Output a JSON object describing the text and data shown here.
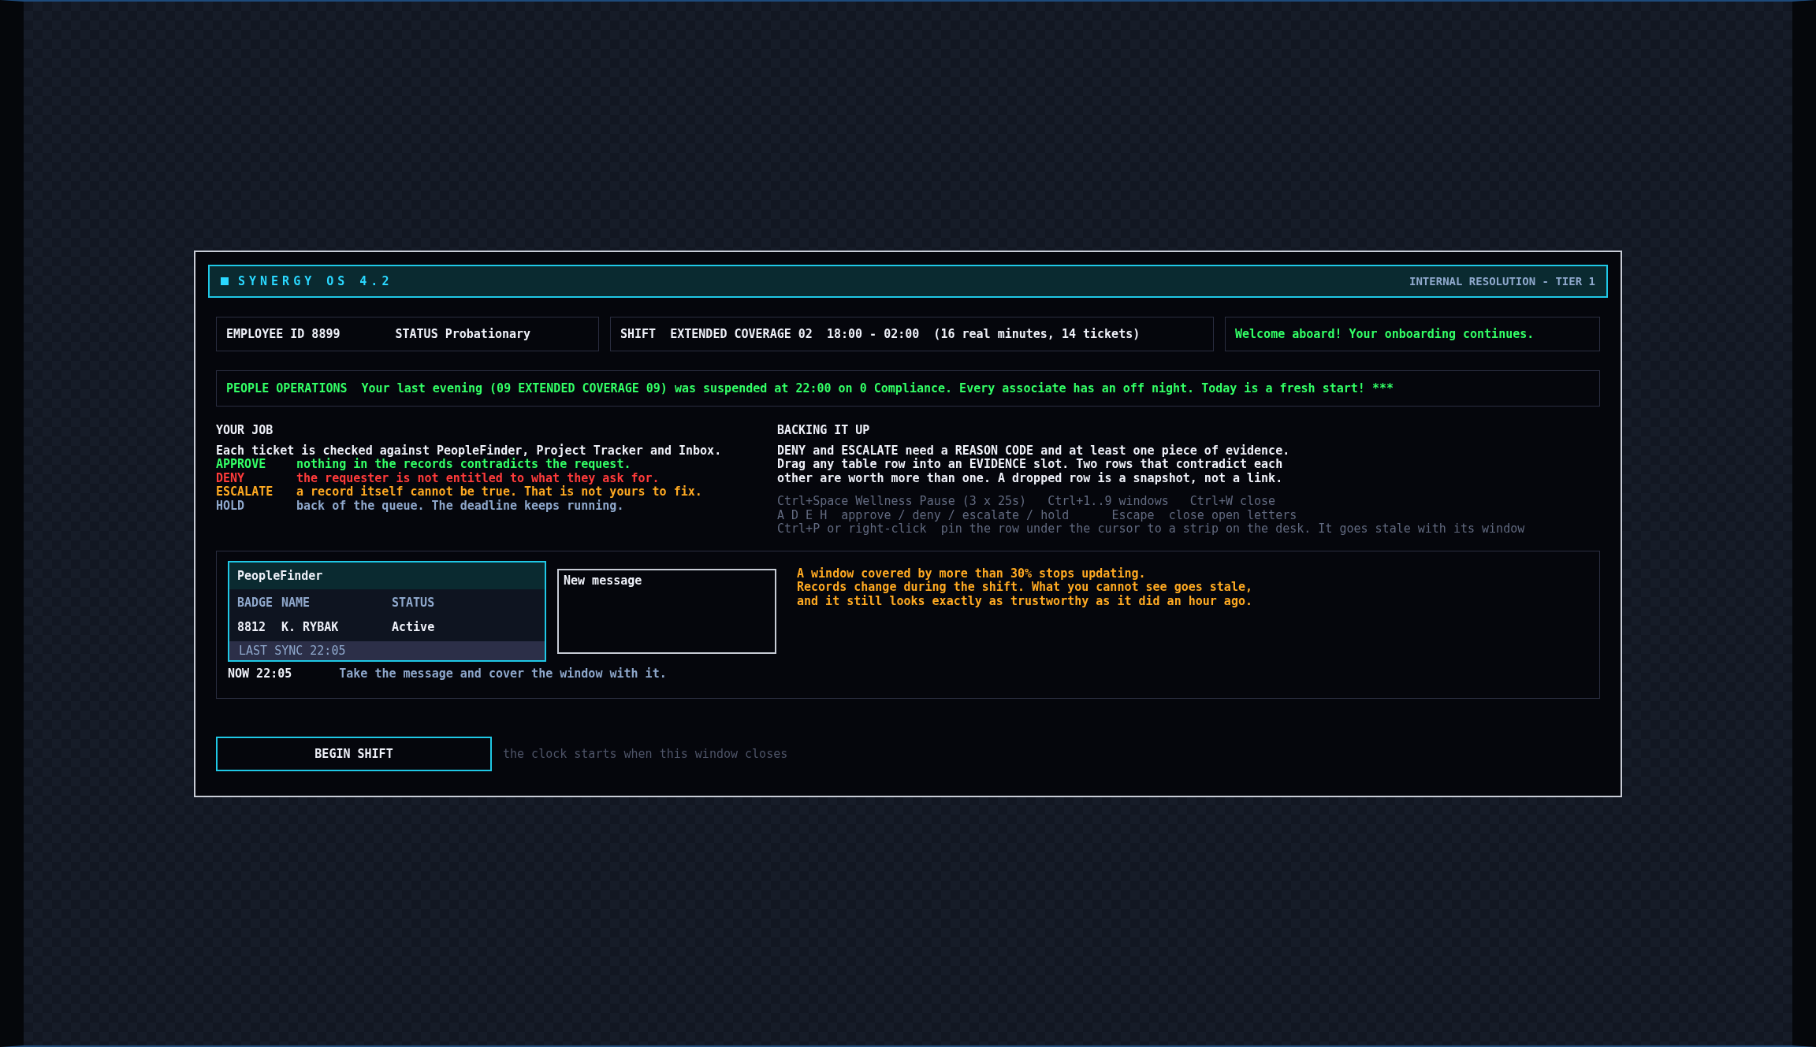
{
  "window": {
    "title": "SYNERGY OS 4.2",
    "tier": "INTERNAL RESOLUTION - TIER 1"
  },
  "info": {
    "employee": "EMPLOYEE ID 8899",
    "status": "STATUS Probationary",
    "shift": "SHIFT  EXTENDED COVERAGE 02  18:00 - 02:00  (16 real minutes, 14 tickets)",
    "welcome": "Welcome aboard! Your onboarding continues."
  },
  "notice": {
    "label": "PEOPLE OPERATIONS",
    "text": "Your last evening (09 EXTENDED COVERAGE 09) was suspended at 22:00 on 0 Compliance. Every associate has an off night. Today is a fresh start! ***"
  },
  "your_job": {
    "heading": "YOUR JOB",
    "intro": "Each ticket is checked against PeopleFinder, Project Tracker and Inbox.",
    "actions": [
      {
        "action": "APPROVE",
        "meaning": "nothing in the records contradicts the request.",
        "color": "#33ff66"
      },
      {
        "action": "DENY",
        "meaning": "the requester is not entitled to what they ask for.",
        "color": "#ff3b3b"
      },
      {
        "action": "ESCALATE",
        "meaning": "a record itself cannot be true. That is not yours to fix.",
        "color": "#ffaa22"
      },
      {
        "action": "HOLD",
        "meaning": "back of the queue. The deadline keeps running.",
        "color": "#8fa8cc"
      }
    ]
  },
  "backing": {
    "heading": "BACKING IT UP",
    "lines": [
      "DENY and ESCALATE need a REASON CODE and at least one piece of evidence.",
      "Drag any table row into an EVIDENCE slot. Two rows that contradict each",
      "other are worth more than one. A dropped row is a snapshot, not a link."
    ],
    "shortcuts": [
      "Ctrl+Space Wellness Pause (3 x 25s)   Ctrl+1..9 windows   Ctrl+W close",
      "A D E H  approve / deny / escalate / hold      Escape  close open letters",
      "Ctrl+P or right-click  pin the row under the cursor to a strip on the desk. It goes stale with its window"
    ]
  },
  "demo": {
    "window_title": "PeopleFinder",
    "columns": [
      "BADGE",
      "NAME",
      "STATUS"
    ],
    "row": [
      "8812",
      "K. RYBAK",
      "Active"
    ],
    "last_sync": "LAST SYNC 22:05",
    "message_title": "New message",
    "now": "NOW 22:05",
    "hint": "Take the message and cover the window with it.",
    "warning": [
      "A window covered by more than 30% stops updating.",
      "Records change during the shift. What you cannot see goes stale,",
      "and it still looks exactly as trustworthy as it did an hour ago."
    ]
  },
  "begin_button": "BEGIN SHIFT",
  "begin_note": "the clock starts when this window closes"
}
